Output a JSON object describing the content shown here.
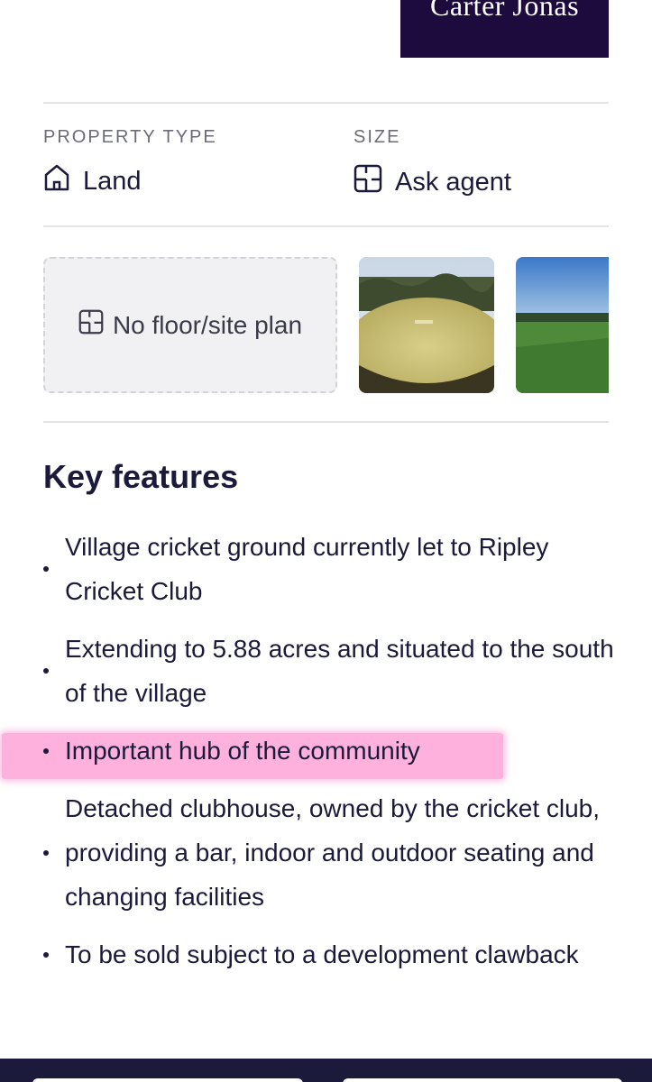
{
  "header": {
    "title_fragment": "",
    "brand": "Carter Jonas"
  },
  "property": {
    "type_label": "PROPERTY TYPE",
    "type_value": "Land",
    "size_label": "SIZE",
    "size_value": "Ask agent"
  },
  "media": {
    "no_plan_text": "No floor/site plan"
  },
  "key_features": {
    "heading": "Key features",
    "items": [
      {
        "text": "Village cricket ground currently let to Ripley Cricket Club"
      },
      {
        "text": "Extending to 5.88 acres and situated to the south of the village"
      },
      {
        "text": "Important hub of the community"
      },
      {
        "text": "Detached clubhouse, owned by the cricket club, providing a bar, indoor and outdoor seating and changing facilities"
      },
      {
        "text": "To be sold subject to a development clawback"
      }
    ]
  },
  "colors": {
    "brand_bg": "#1e0b3d",
    "text": "#1b1a3a",
    "highlight": "#fdb1dc"
  }
}
